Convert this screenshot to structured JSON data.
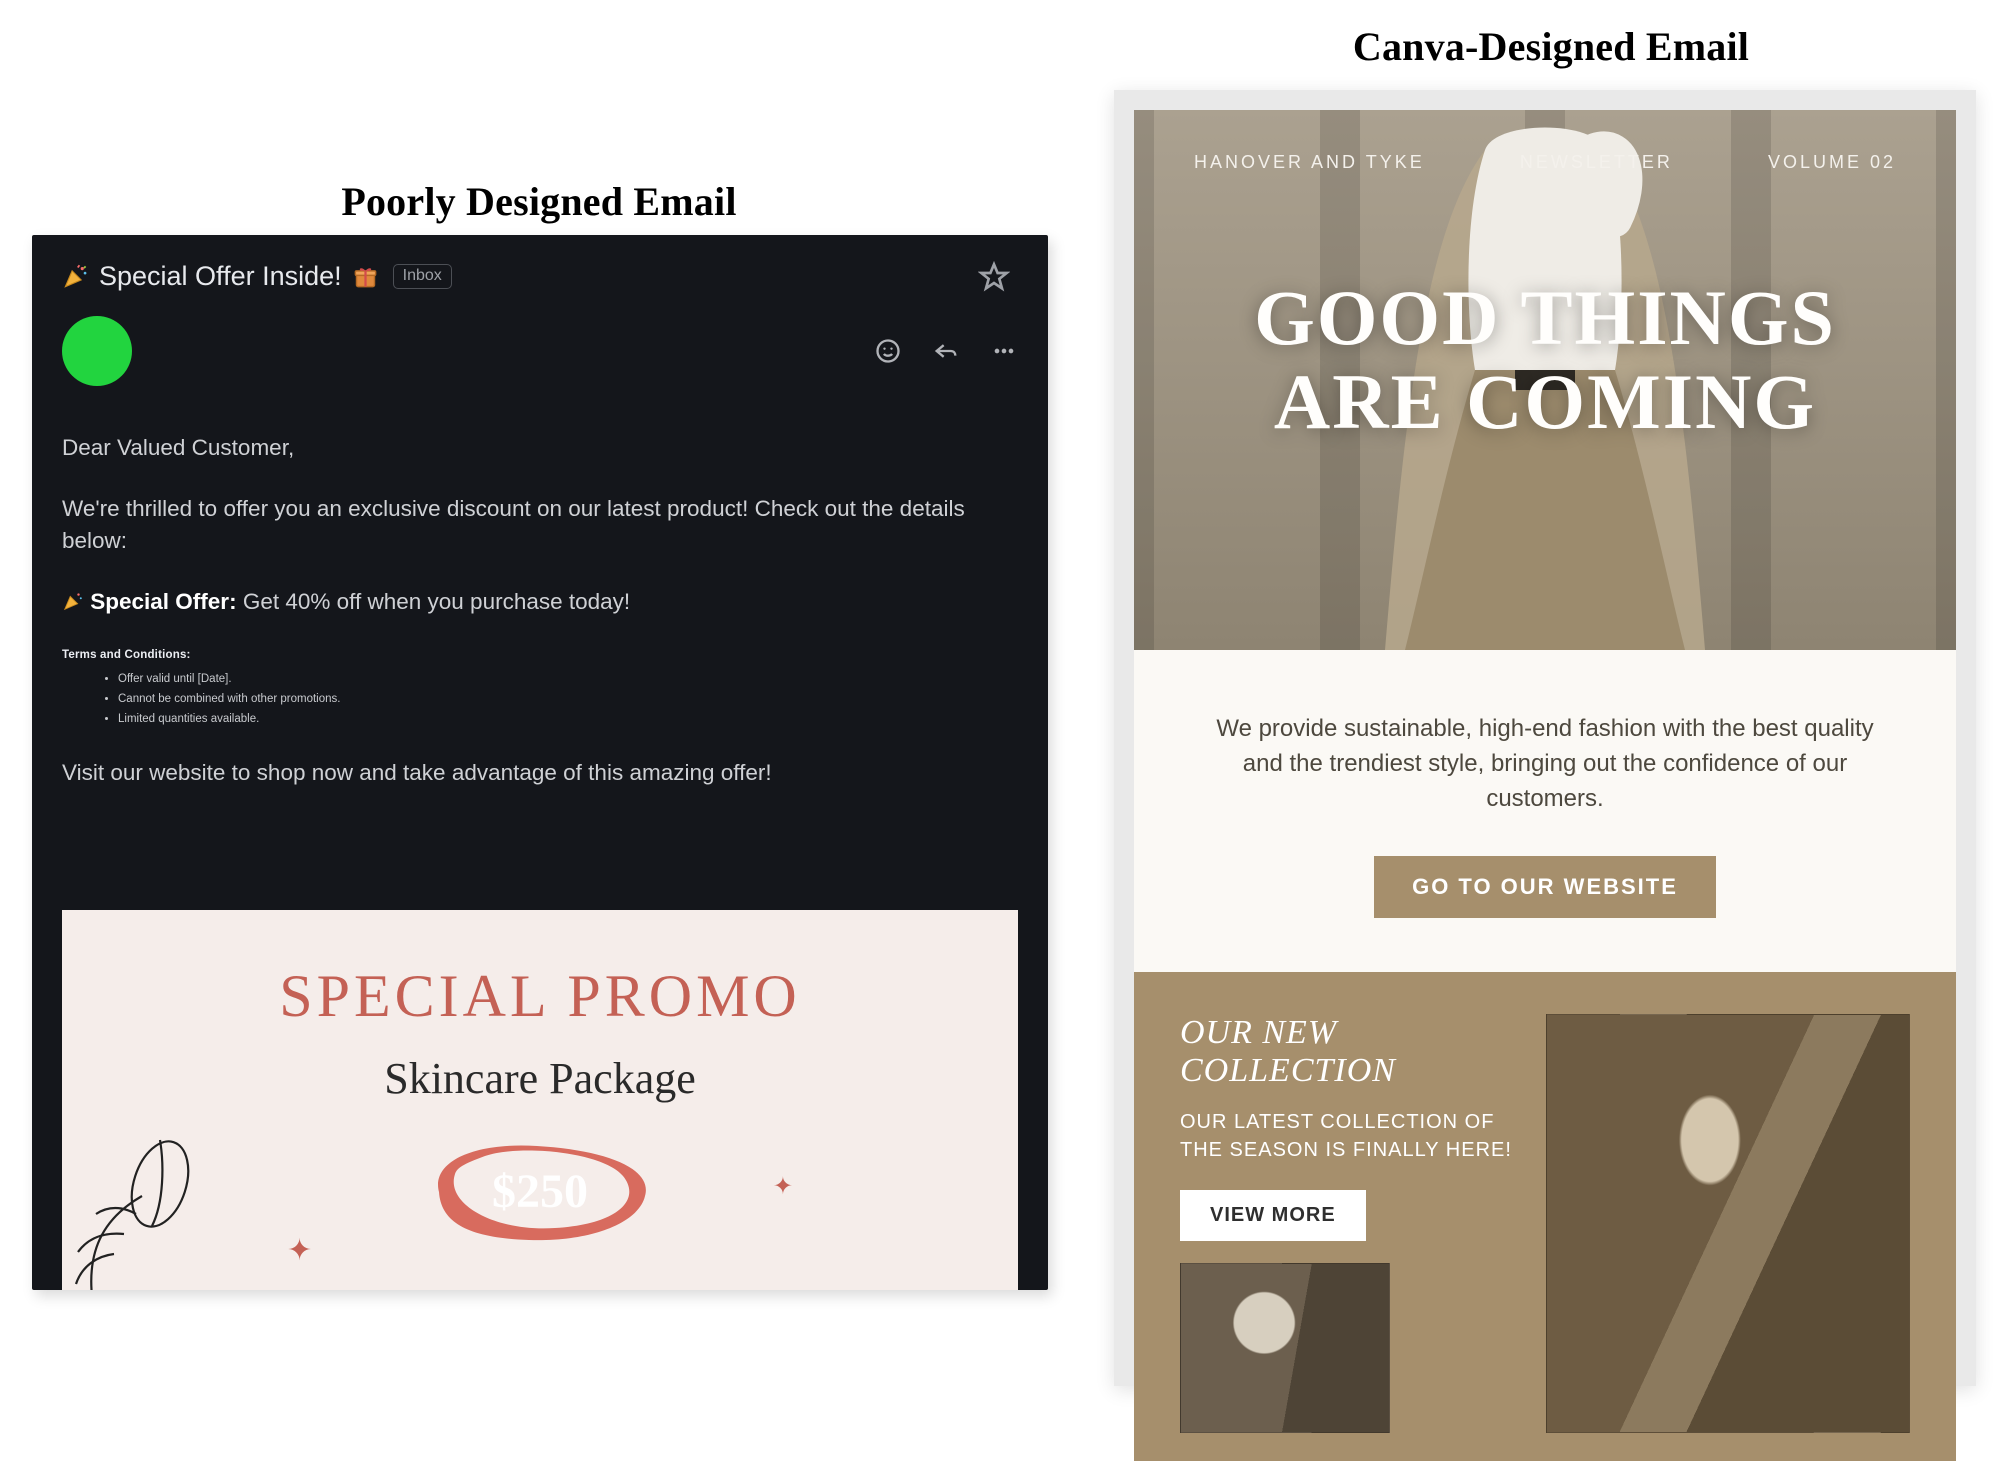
{
  "titles": {
    "left": "Poorly Designed Email",
    "right": "Canva-Designed Email"
  },
  "left_email": {
    "subject_prefix_icon": "party-popper",
    "subject": "Special Offer Inside!",
    "subject_suffix_icon": "gift",
    "inbox_badge": "Inbox",
    "body": {
      "greeting": "Dear Valued Customer,",
      "intro": "We're thrilled to offer you an exclusive discount on our latest product! Check out the details below:",
      "offer_icon": "party-popper",
      "offer_label": "Special Offer:",
      "offer_text": "Get 40% off when you purchase today!",
      "terms_title": "Terms and Conditions:",
      "terms": [
        "Offer valid until [Date].",
        "Cannot be combined with other promotions.",
        "Limited quantities available."
      ],
      "outro": "Visit our website to shop now and take advantage of this amazing offer!"
    },
    "promo": {
      "heading": "SPECIAL PROMO",
      "subheading": "Skincare Package",
      "price": "$250"
    }
  },
  "right_email": {
    "hero": {
      "topbar": {
        "left": "HANOVER AND TYKE",
        "center": "NEWSLETTER",
        "right": "VOLUME 02"
      },
      "headline_line1": "GOOD THINGS",
      "headline_line2": "ARE COMING"
    },
    "mid": {
      "copy": "We provide sustainable, high-end fashion with the best quality and the trendiest style, bringing out the confidence of our customers.",
      "cta": "GO TO OUR WEBSITE"
    },
    "collection": {
      "title": "OUR NEW COLLECTION",
      "copy": "OUR LATEST COLLECTION OF THE SEASON IS FINALLY HERE!",
      "cta": "VIEW MORE"
    }
  }
}
